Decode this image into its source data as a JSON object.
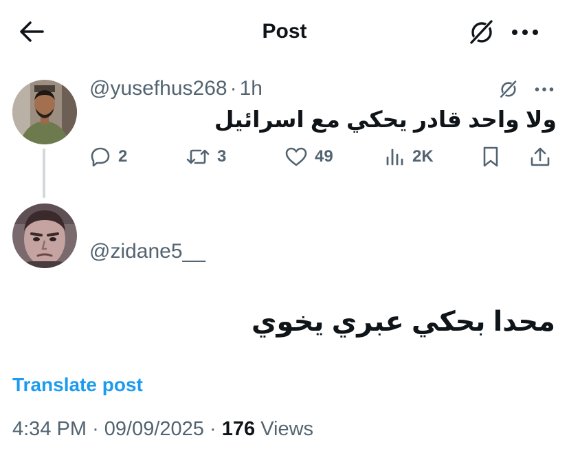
{
  "header": {
    "title": "Post",
    "back_icon": "arrow-left-icon",
    "grok_icon": "grok-icon",
    "more_icon": "more-horizontal-icon"
  },
  "parent_post": {
    "handle": "@yusefhus268",
    "separator": "·",
    "time": "1h",
    "text": "ولا واحد قادر يحكي مع اسرائيل",
    "actions": {
      "replies": "2",
      "reposts": "3",
      "likes": "49",
      "views": "2K"
    }
  },
  "reply": {
    "handle": "@zidane5__",
    "text": "محدا بحكي عبري يخوي",
    "translate_label": "Translate post",
    "time": "4:34 PM",
    "separator": "·",
    "date": "09/09/2025",
    "views_count": "176",
    "views_label": "Views"
  },
  "colors": {
    "text_primary": "#0f1419",
    "text_secondary": "#536471",
    "link": "#1d9bf0",
    "thread_line": "#cfd9de"
  }
}
